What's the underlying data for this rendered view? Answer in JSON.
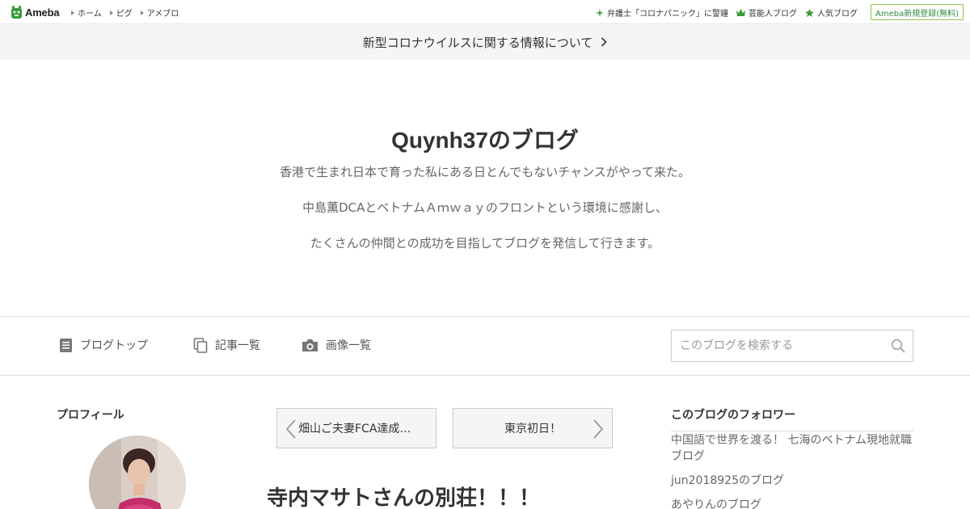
{
  "header": {
    "logo_text": "Ameba",
    "nav": [
      "ホーム",
      "ピグ",
      "アメブロ"
    ],
    "right_links": [
      {
        "label": "弁護士「コロナパニック」に警鐘",
        "icon": "sparkle-icon"
      },
      {
        "label": "芸能人ブログ",
        "icon": "crown-icon"
      },
      {
        "label": "人気ブログ",
        "icon": "star-icon"
      }
    ],
    "register_label": "Ameba新規登録(無料)"
  },
  "notice": {
    "text": "新型コロナウイルスに関する情報について"
  },
  "blog": {
    "title": "Quynh37のブログ",
    "description": [
      "香港で生まれ日本で育った私にある日とんでもないチャンスがやって来た。",
      "中島薫DCAとベトナムＡｍｗａｙのフロントという環境に感謝し、",
      "たくさんの仲間との成功を目指してブログを発信して行きます。"
    ]
  },
  "blog_nav": {
    "items": [
      "ブログトップ",
      "記事一覧",
      "画像一覧"
    ],
    "search_placeholder": "このブログを検索する"
  },
  "profile": {
    "heading": "プロフィール"
  },
  "pager": {
    "prev": "畑山ご夫妻FCA達成…",
    "next": "東京初日！"
  },
  "entry": {
    "title": "寺内マサトさんの別荘！！！"
  },
  "followers": {
    "heading": "このブログのフォロワー",
    "items": [
      "中国語で世界を渡る！ 七海のベトナム現地就職ブログ",
      "jun2018925のブログ",
      "あやりんのブログ"
    ]
  },
  "colors": {
    "accent_green": "#2d8c3c",
    "border": "#dddddd"
  }
}
